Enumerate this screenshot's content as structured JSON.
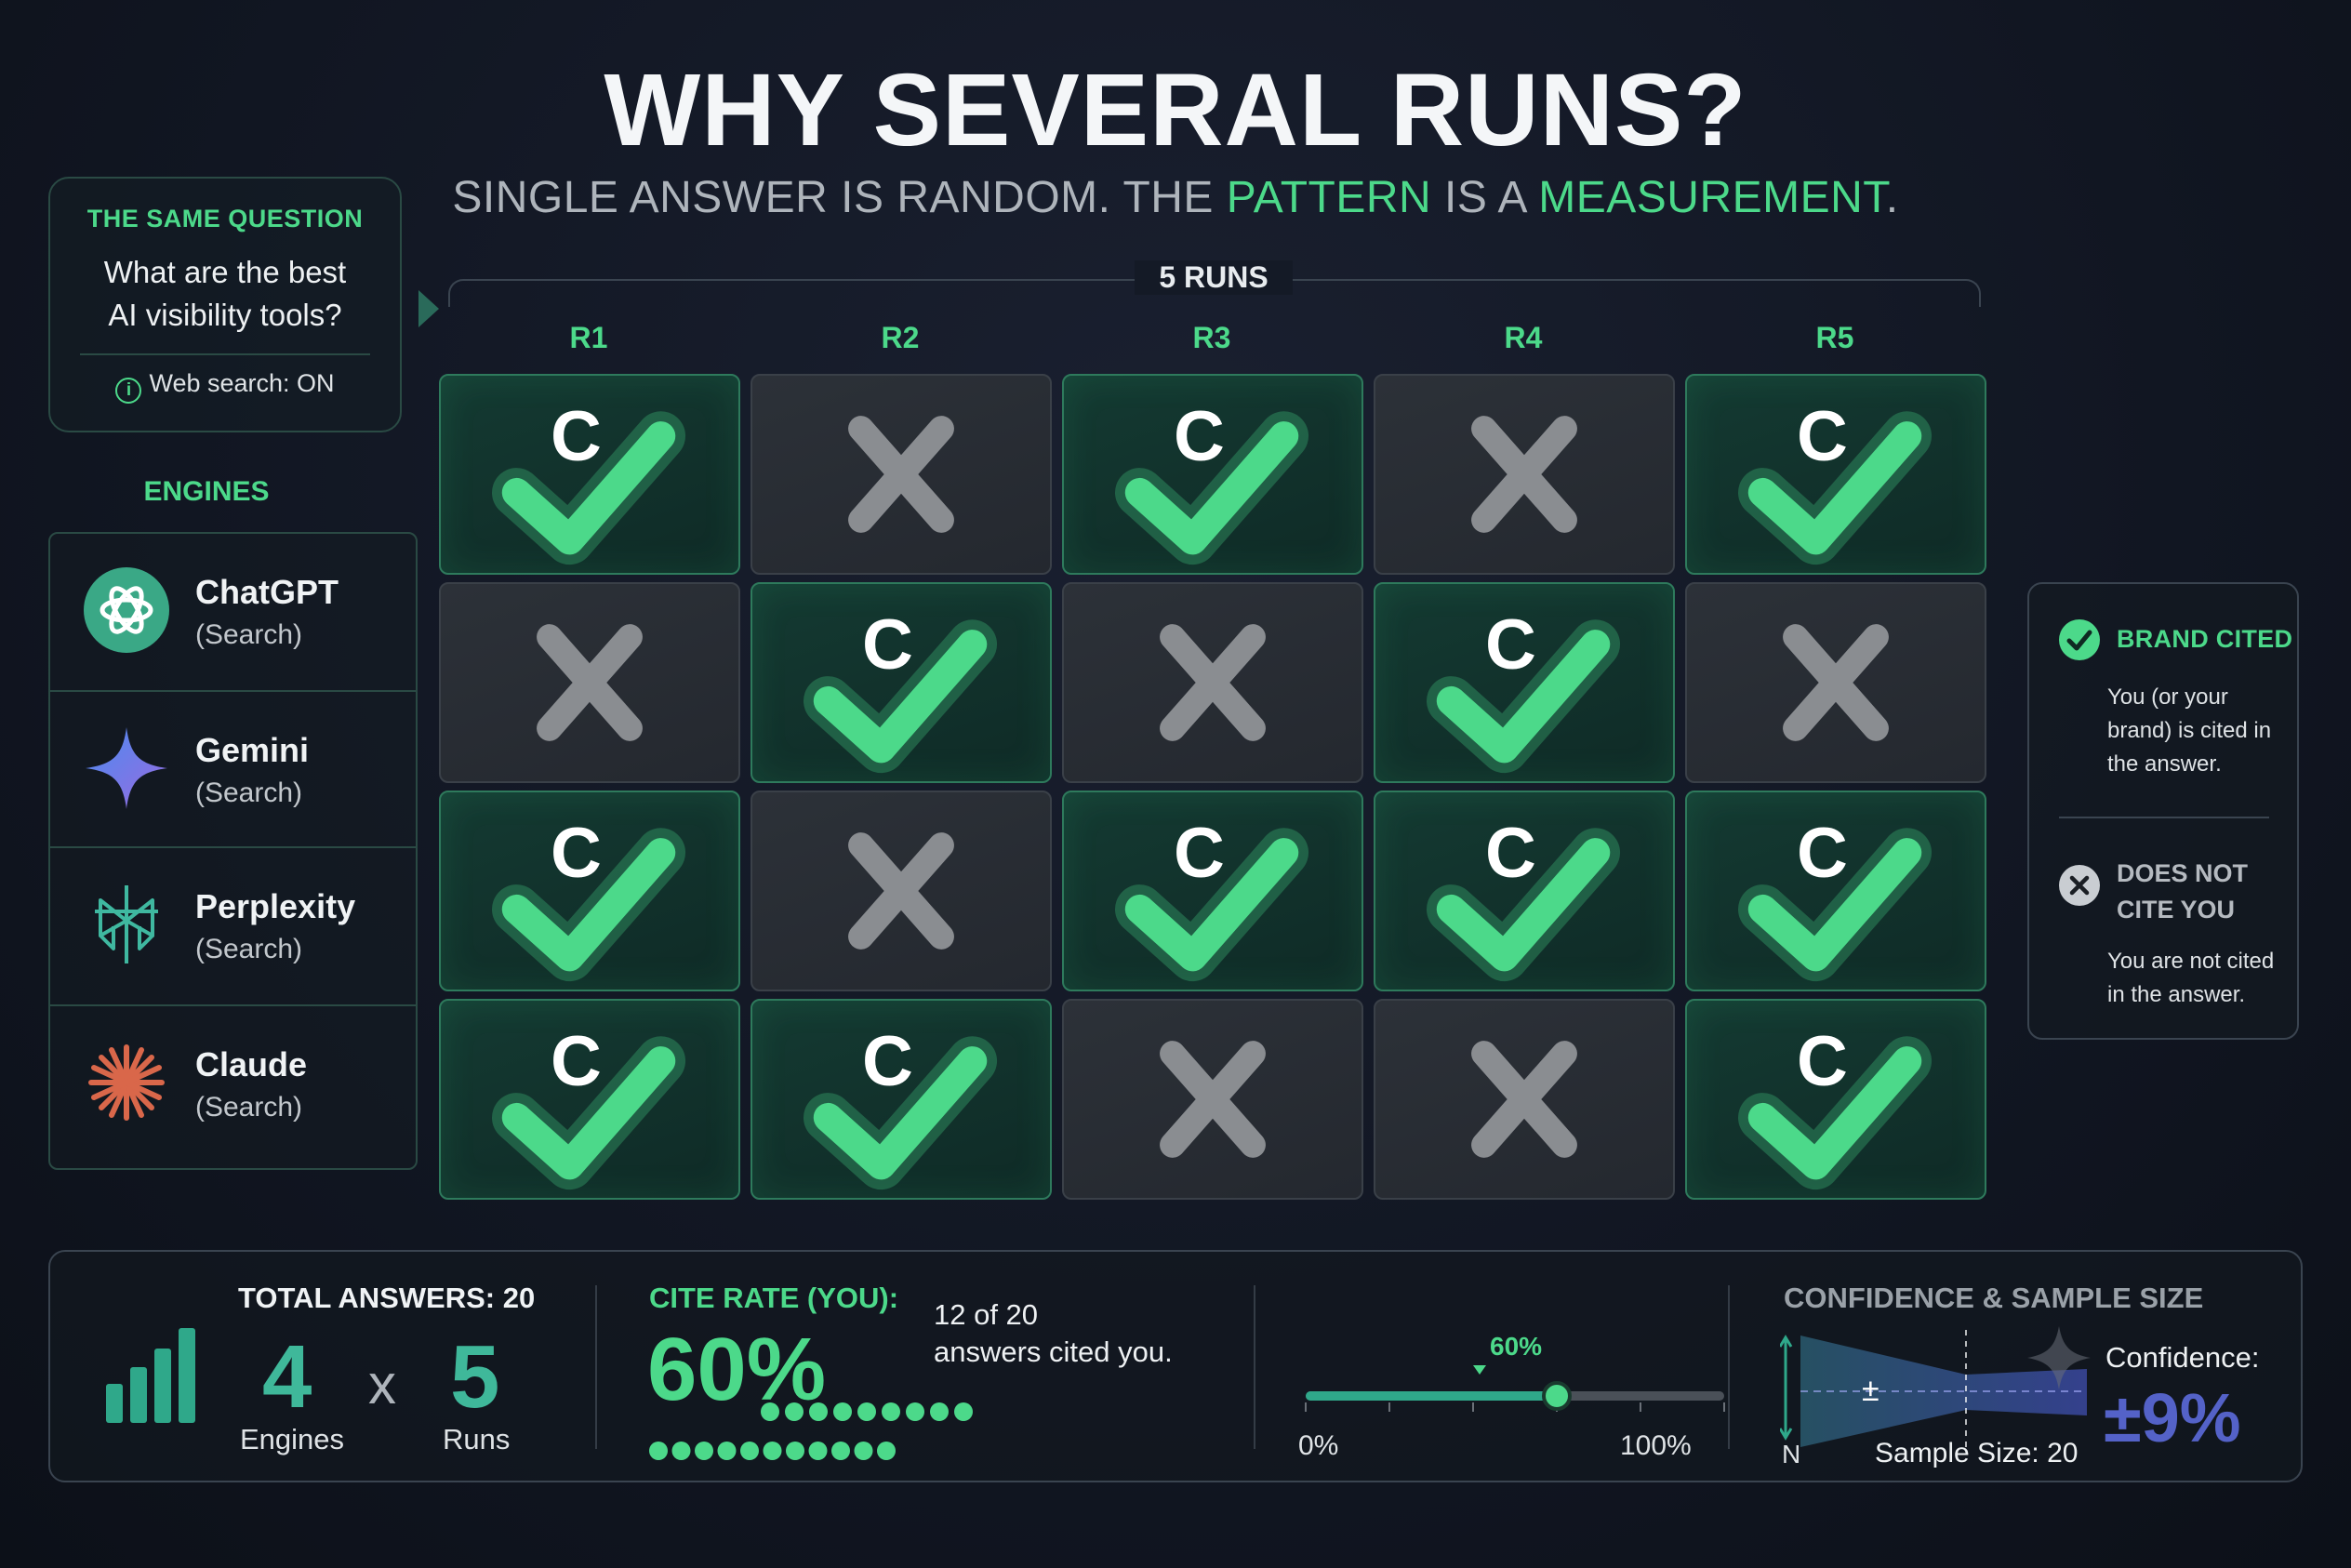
{
  "title": "WHY SEVERAL RUNS?",
  "subtitle": {
    "part1": "SINGLE ANSWER IS RANDOM. THE ",
    "hl1": "PATTERN",
    "part2": " IS A ",
    "hl2": "MEASUREMENT",
    "part3": "."
  },
  "question": {
    "heading": "THE SAME QUESTION",
    "line1": "What are the best",
    "line2": "AI visibility tools?",
    "footer": "Web search: ON",
    "footer_icon": "info-icon"
  },
  "runs": {
    "label": "5 RUNS",
    "headers": [
      "R1",
      "R2",
      "R3",
      "R4",
      "R5"
    ]
  },
  "engines": {
    "label": "ENGINES",
    "items": [
      {
        "name": "ChatGPT",
        "mode": "(Search)",
        "icon": "chatgpt-logo-icon"
      },
      {
        "name": "Gemini",
        "mode": "(Search)",
        "icon": "gemini-logo-icon"
      },
      {
        "name": "Perplexity",
        "mode": "(Search)",
        "icon": "perplexity-logo-icon"
      },
      {
        "name": "Claude",
        "mode": "(Search)",
        "icon": "claude-logo-icon"
      }
    ]
  },
  "grid": {
    "cited_letter": "C",
    "rows": [
      [
        true,
        false,
        true,
        false,
        true
      ],
      [
        false,
        true,
        false,
        true,
        false
      ],
      [
        true,
        false,
        true,
        true,
        true
      ],
      [
        true,
        true,
        false,
        false,
        true
      ]
    ]
  },
  "legend": {
    "cited_title": "BRAND CITED",
    "cited_desc": "You (or your brand) is cited in the answer.",
    "not_title": "DOES NOT CITE YOU",
    "not_desc": "You are not cited in the answer."
  },
  "summary": {
    "total_label": "TOTAL ANSWERS: 20",
    "engines_count": "4",
    "engines_label": "Engines",
    "times": "x",
    "runs_count": "5",
    "runs_label": "Runs",
    "cite_label": "CITE RATE (YOU):",
    "cite_pct": "60%",
    "cite_note_1": "12 of 20",
    "cite_note_2": "answers cited you.",
    "cited_count": 12,
    "total_count": 20,
    "slider_pct": "60%",
    "slider_value": 0.6,
    "slider_min": "0%",
    "slider_max": "100%",
    "conf_label": "CONFIDENCE & SAMPLE SIZE",
    "conf_text": "Confidence:",
    "conf_val": "±9%",
    "conf_n": "N",
    "conf_pm": "±",
    "conf_sample": "Sample Size: 20"
  },
  "colors": {
    "accent": "#4cd98a",
    "teal": "#3fb89a",
    "conf": "#5462c8",
    "grey_x": "#8a8d91"
  }
}
